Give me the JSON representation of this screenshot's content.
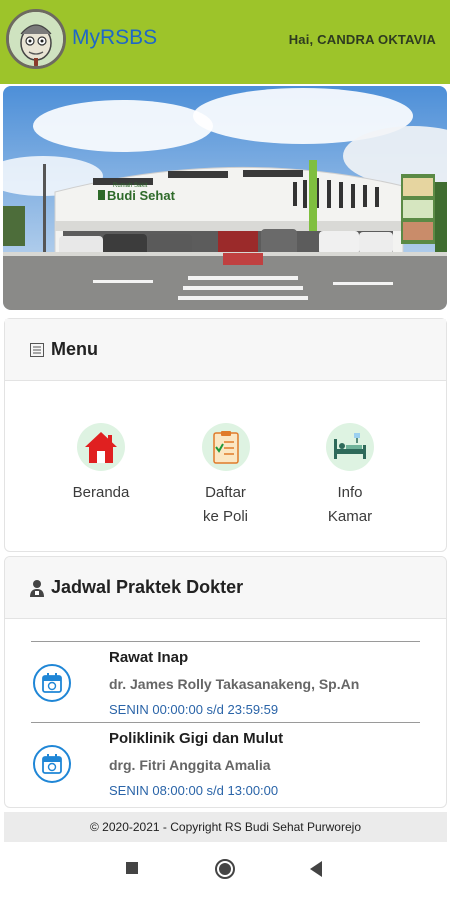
{
  "header": {
    "app_title": "MyRSBS",
    "greeting": "Hai, CANDRA OKTAVIA"
  },
  "banner": {
    "sign_small": "Rumah Sakit",
    "sign_large": "Budi Sehat"
  },
  "menu": {
    "title": "Menu",
    "items": [
      {
        "label": "Beranda",
        "icon": "home-icon"
      },
      {
        "label": "Daftar\nke Poli",
        "icon": "clipboard-register-icon"
      },
      {
        "label": "Info\nKamar",
        "icon": "hospital-bed-icon"
      }
    ]
  },
  "schedule": {
    "title": "Jadwal Praktek Dokter",
    "rows": [
      {
        "unit": "Rawat Inap",
        "doctor": "dr. James Rolly Takasanakeng, Sp.An",
        "time": "SENIN 00:00:00 s/d 23:59:59"
      },
      {
        "unit": "Poliklinik Gigi dan Mulut",
        "doctor": "drg. Fitri Anggita Amalia",
        "time": "SENIN 08:00:00 s/d 13:00:00"
      }
    ]
  },
  "footer": {
    "copyright": "© 2020-2021 - Copyright RS Budi Sehat Purworejo"
  },
  "colors": {
    "header": "#9dc42a",
    "title": "#1f67c7",
    "accent_blue": "#1f86d6"
  }
}
